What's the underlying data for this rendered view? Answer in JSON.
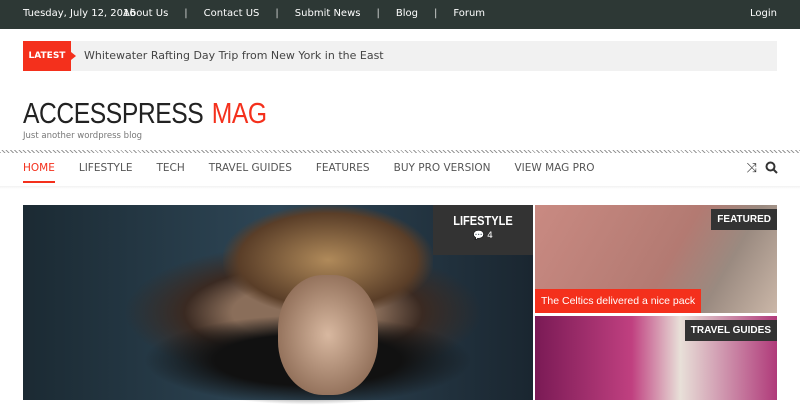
{
  "topbar": {
    "date": "Tuesday, July 12, 2016",
    "links": [
      "About Us",
      "Contact US",
      "Submit News",
      "Blog",
      "Forum"
    ],
    "login": "Login"
  },
  "ticker": {
    "label": "LATEST",
    "headline": "Whitewater Rafting Day Trip from New York in the East"
  },
  "site": {
    "name": "ACCESSPRESS",
    "name_accent": "MAG",
    "tagline": "Just another wordpress blog"
  },
  "nav": {
    "items": [
      "HOME",
      "LIFESTYLE",
      "TECH",
      "TRAVEL GUIDES",
      "FEATURES",
      "BUY PRO VERSION",
      "VIEW MAG PRO"
    ],
    "active": "HOME"
  },
  "featured": {
    "main": {
      "category": "LIFESTYLE",
      "comments": "4"
    },
    "top_right": {
      "category": "FEATURED",
      "title": "The Celtics delivered a nice pack"
    },
    "bottom_right": {
      "category": "TRAVEL GUIDES"
    }
  },
  "colors": {
    "accent": "#f4301c",
    "topbar": "#2d3835"
  }
}
